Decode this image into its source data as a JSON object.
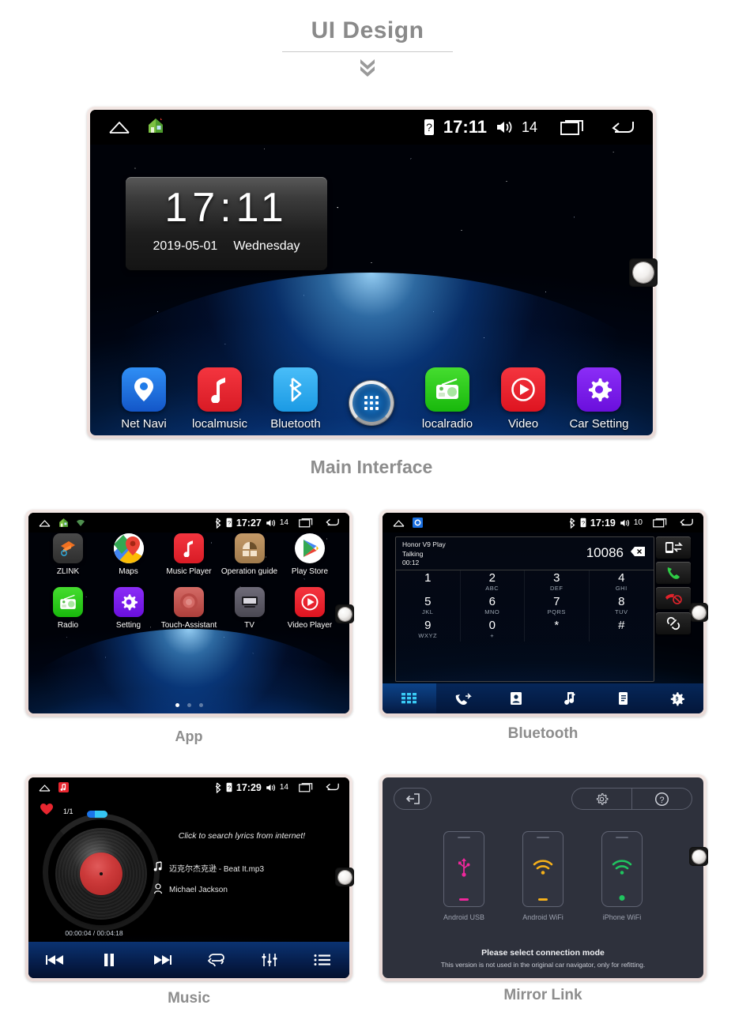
{
  "header": {
    "title": "UI Design",
    "chevron_icon": "chevron-double-down-icon"
  },
  "captions": {
    "main": "Main Interface",
    "app": "App",
    "bluetooth": "Bluetooth",
    "music": "Music",
    "mirror": "Mirror Link"
  },
  "main_screen": {
    "statusbar": {
      "home_icon": "home-icon",
      "house_app_icon": "house-app-icon",
      "sim_icon": "sim-unknown-icon",
      "time": "17:11",
      "volume_icon": "volume-icon",
      "volume": "14",
      "recents_icon": "recents-icon",
      "back_icon": "back-arrow-icon"
    },
    "clock_widget": {
      "time": "17:11",
      "date": "2019-05-01",
      "weekday": "Wednesday"
    },
    "dock": [
      {
        "label": "Net Navi",
        "icon": "map-pin-icon",
        "color": "#1a6fe0"
      },
      {
        "label": "localmusic",
        "icon": "music-note-icon",
        "color": "#e8262f"
      },
      {
        "label": "Bluetooth",
        "icon": "bluetooth-icon",
        "color": "#2badf2"
      },
      {
        "label": "",
        "icon": "app-drawer-icon",
        "color": "#0b4f92"
      },
      {
        "label": "localradio",
        "icon": "radio-icon",
        "color": "#2ecb1e"
      },
      {
        "label": "Video",
        "icon": "play-circle-icon",
        "color": "#ef1b2c"
      },
      {
        "label": "Car Setting",
        "icon": "gear-icon",
        "color": "#7a1ef0"
      }
    ]
  },
  "app_screen": {
    "statusbar": {
      "home_icon": "home-icon",
      "house_app_icon": "house-app-icon",
      "wifi_icon": "wifi-icon",
      "bluetooth_icon": "bluetooth-icon",
      "sim_icon": "sim-unknown-icon",
      "time": "17:27",
      "volume_icon": "volume-icon",
      "volume": "14",
      "recents_icon": "recents-icon",
      "back_icon": "back-arrow-icon"
    },
    "rows": [
      [
        {
          "label": "ZLINK",
          "icon": "zlink-icon",
          "color": "#3a3a3a"
        },
        {
          "label": "Maps",
          "icon": "google-maps-icon",
          "color": "#ffffff"
        },
        {
          "label": "Music Player",
          "icon": "music-note-icon",
          "color": "#e8262f"
        },
        {
          "label": "Operation guide",
          "icon": "book-guide-icon",
          "color": "#b08a5e"
        },
        {
          "label": "Play Store",
          "icon": "play-store-icon",
          "color": "#ffffff"
        }
      ],
      [
        {
          "label": "Radio",
          "icon": "radio-icon",
          "color": "#2ecb1e"
        },
        {
          "label": "Setting",
          "icon": "gear-icon",
          "color": "#7a1ef0"
        },
        {
          "label": "Touch-Assistant",
          "icon": "touch-button-icon",
          "color": "#c0504d"
        },
        {
          "label": "TV",
          "icon": "tv-icon",
          "color": "#5c5a66"
        },
        {
          "label": "Video Player",
          "icon": "play-circle-icon",
          "color": "#ef1b2c"
        }
      ]
    ],
    "page_dots": [
      "on",
      "off",
      "off"
    ]
  },
  "bluetooth_screen": {
    "statusbar": {
      "home_icon": "home-icon",
      "notification_icon": "bt-phone-notification-icon",
      "bluetooth_icon": "bluetooth-icon",
      "sim_icon": "sim-unknown-icon",
      "time": "17:19",
      "volume_icon": "volume-icon",
      "volume": "10",
      "recents_icon": "recents-icon",
      "back_icon": "back-arrow-icon"
    },
    "call": {
      "device_name": "Honor V9 Play",
      "state": "Talking",
      "duration": "00:12",
      "number": "10086",
      "backspace_icon": "backspace-icon"
    },
    "keypad": [
      {
        "digit": "1",
        "sub": ""
      },
      {
        "digit": "2",
        "sub": "ABC"
      },
      {
        "digit": "3",
        "sub": "DEF"
      },
      {
        "digit": "4",
        "sub": "GHI"
      },
      {
        "digit": "5",
        "sub": "JKL"
      },
      {
        "digit": "6",
        "sub": "MNO"
      },
      {
        "digit": "7",
        "sub": "PQRS"
      },
      {
        "digit": "8",
        "sub": "TUV"
      },
      {
        "digit": "9",
        "sub": "WXYZ"
      },
      {
        "digit": "0",
        "sub": "+"
      },
      {
        "digit": "*",
        "sub": ""
      },
      {
        "digit": "#",
        "sub": ""
      }
    ],
    "side_buttons": [
      {
        "icon": "transfer-audio-icon",
        "color": "#ffffff"
      },
      {
        "icon": "call-answer-icon",
        "color": "#2ecc45"
      },
      {
        "icon": "call-end-icon",
        "color": "#e0232b"
      },
      {
        "icon": "link-icon",
        "color": "#ffffff"
      }
    ],
    "nav": [
      {
        "icon": "dialpad-icon",
        "active": true
      },
      {
        "icon": "call-history-icon",
        "active": false
      },
      {
        "icon": "contacts-icon",
        "active": false
      },
      {
        "icon": "bt-music-icon",
        "active": false
      },
      {
        "icon": "phonebook-sync-icon",
        "active": false
      },
      {
        "icon": "gear-icon",
        "active": false
      }
    ]
  },
  "music_screen": {
    "statusbar": {
      "home_icon": "home-icon",
      "music_notification_icon": "music-notification-icon",
      "bluetooth_icon": "bluetooth-icon",
      "sim_icon": "sim-unknown-icon",
      "time": "17:29",
      "volume_icon": "volume-icon",
      "volume": "14",
      "recents_icon": "recents-icon",
      "back_icon": "back-arrow-icon"
    },
    "favorite_icon": "heart-icon",
    "track_count": "1/1",
    "lyrics_hint": "Click to search lyrics from internet!",
    "track_title": "迈克尔杰克逊 - Beat It.mp3",
    "artist": "Michael Jackson",
    "elapsed_total": "00:00:04 / 00:04:18",
    "controls": [
      {
        "icon": "previous-track-icon"
      },
      {
        "icon": "pause-icon"
      },
      {
        "icon": "next-track-icon"
      },
      {
        "icon": "repeat-icon"
      },
      {
        "icon": "equalizer-icon"
      },
      {
        "icon": "playlist-icon"
      }
    ]
  },
  "mirror_screen": {
    "exit_icon": "exit-icon",
    "settings_icon": "gear-icon",
    "help_icon": "help-circle-icon",
    "modes": [
      {
        "label": "Android USB",
        "icon": "usb-icon",
        "color": "#f0279c"
      },
      {
        "label": "Android WiFi",
        "icon": "wifi-icon",
        "color": "#f5b01a"
      },
      {
        "label": "iPhone WiFi",
        "icon": "wifi-icon",
        "color": "#20c45f"
      }
    ],
    "footer_title": "Please select connection mode",
    "footer_note": "This version is not used in the original car navigator, only for refitting."
  }
}
